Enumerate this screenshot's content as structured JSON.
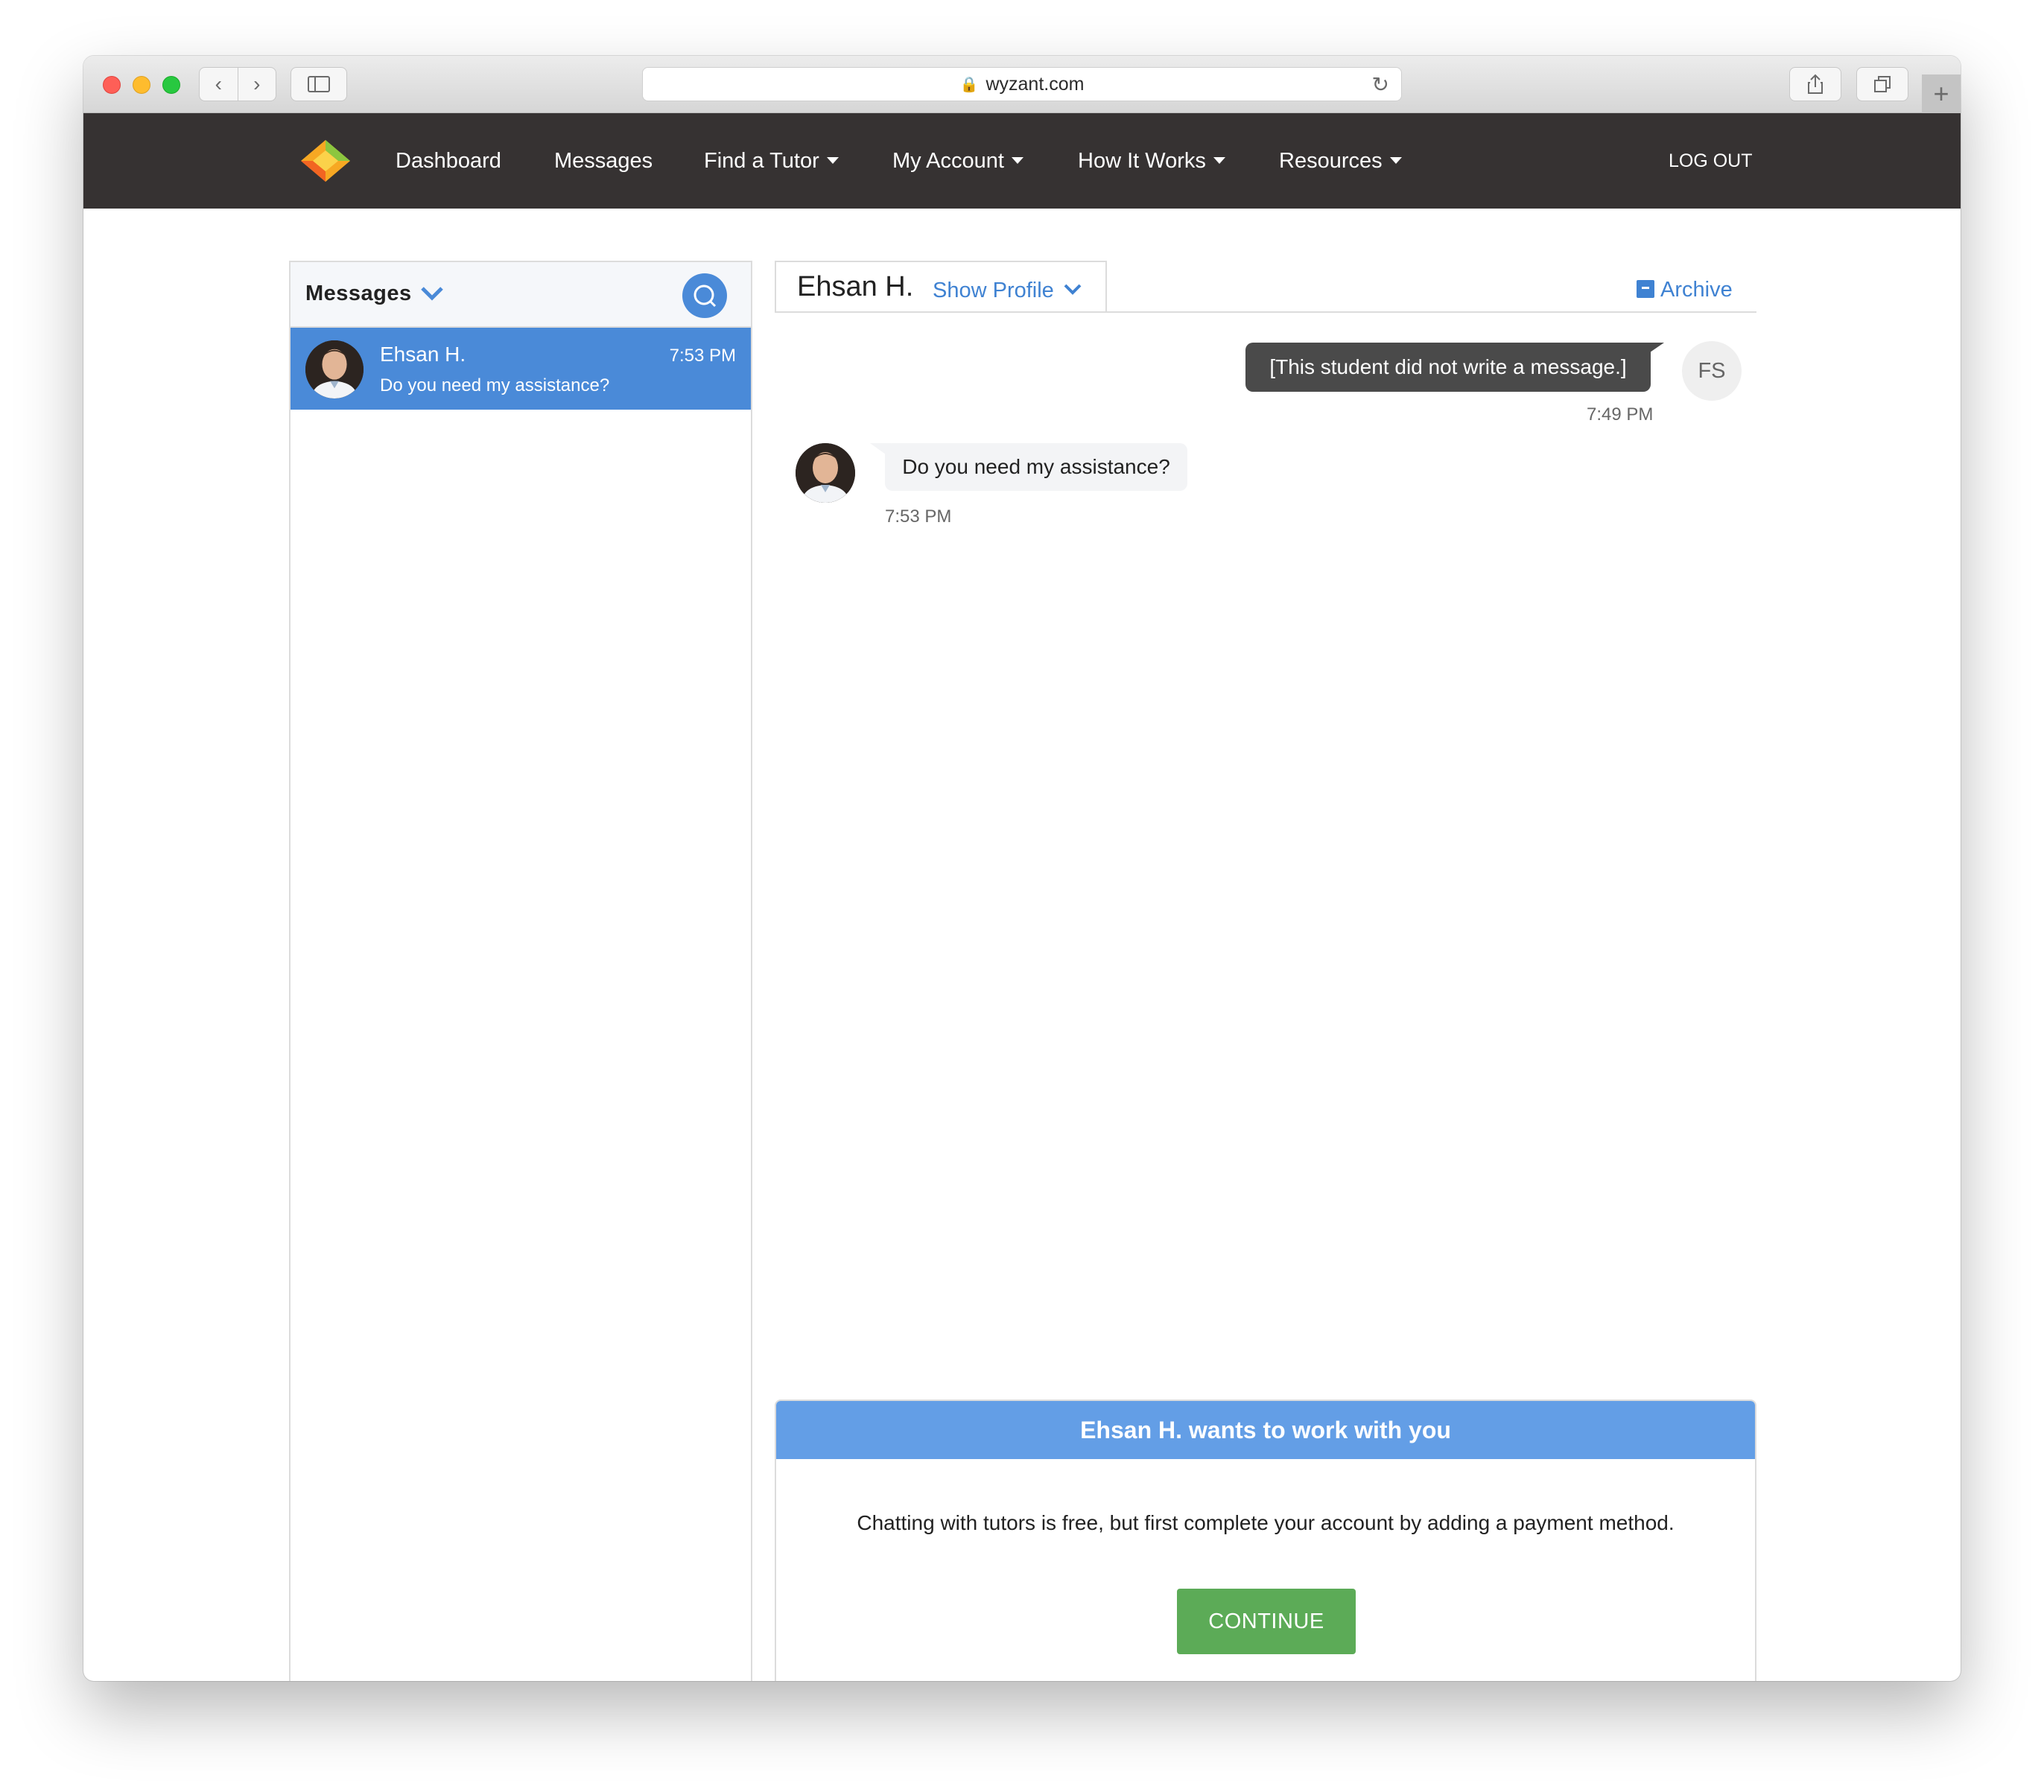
{
  "browser": {
    "url": "wyzant.com"
  },
  "navbar": {
    "items": [
      {
        "label": "Dashboard"
      },
      {
        "label": "Messages"
      },
      {
        "label": "Find a Tutor"
      },
      {
        "label": "My Account"
      },
      {
        "label": "How It Works"
      },
      {
        "label": "Resources"
      }
    ],
    "logout": "LOG OUT"
  },
  "messages_panel": {
    "title": "Messages",
    "conversations": [
      {
        "name": "Ehsan H.",
        "time": "7:53 PM",
        "preview": "Do you need my assistance?"
      }
    ]
  },
  "chat": {
    "contact_name": "Ehsan H.",
    "show_profile": "Show Profile",
    "archive": "Archive",
    "messages": [
      {
        "direction": "outgoing",
        "text": "[This student did not write a message.]",
        "time": "7:49 PM",
        "avatar_initials": "FS"
      },
      {
        "direction": "incoming",
        "text": "Do you need my assistance?",
        "time": "7:53 PM"
      }
    ]
  },
  "offer": {
    "title": "Ehsan H. wants to work with you",
    "body": "Chatting with tutors is free, but first complete your account by adding a payment method.",
    "button": "CONTINUE"
  },
  "colors": {
    "navbar": "#363232",
    "accent_blue": "#4a8ad8",
    "link_blue": "#3f82d2",
    "offer_header": "#639ee6",
    "continue_green": "#5cab57"
  }
}
